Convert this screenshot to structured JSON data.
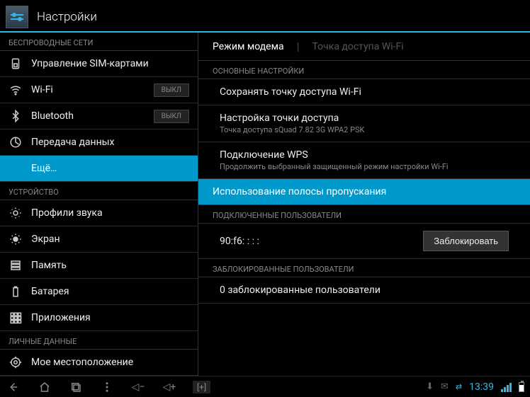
{
  "app_title": "Настройки",
  "sidebar": {
    "sections": [
      {
        "header": "БЕСПРОВОДНЫЕ СЕТИ",
        "items": [
          {
            "icon": "sim",
            "label": "Управление SIM-картами",
            "toggle": null,
            "selected": false
          },
          {
            "icon": "wifi",
            "label": "Wi-Fi",
            "toggle": "ВЫКЛ",
            "selected": false
          },
          {
            "icon": "bluetooth",
            "label": "Bluetooth",
            "toggle": "ВЫКЛ",
            "selected": false
          },
          {
            "icon": "datausage",
            "label": "Передача данных",
            "toggle": null,
            "selected": false
          },
          {
            "icon": "none",
            "label": "Ещё…",
            "toggle": null,
            "selected": true
          }
        ]
      },
      {
        "header": "УСТРОЙСТВО",
        "items": [
          {
            "icon": "audio",
            "label": "Профили звука",
            "toggle": null,
            "selected": false
          },
          {
            "icon": "display",
            "label": "Экран",
            "toggle": null,
            "selected": false
          },
          {
            "icon": "storage",
            "label": "Память",
            "toggle": null,
            "selected": false
          },
          {
            "icon": "battery",
            "label": "Батарея",
            "toggle": null,
            "selected": false
          },
          {
            "icon": "apps",
            "label": "Приложения",
            "toggle": null,
            "selected": false
          }
        ]
      },
      {
        "header": "ЛИЧНЫЕ ДАННЫЕ",
        "items": [
          {
            "icon": "location",
            "label": "Мое местоположение",
            "toggle": null,
            "selected": false
          }
        ]
      }
    ]
  },
  "main": {
    "tabs": {
      "active": "Режим модема",
      "inactive": "Точка доступа Wi-Fi"
    },
    "groups": [
      {
        "header": "ОСНОВНЫЕ НАСТРОЙКИ",
        "items": [
          {
            "title": "Сохранять точку доступа Wi-Fi",
            "sub": null,
            "highlighted": false
          },
          {
            "title": "Настройка точки доступа",
            "sub": "Точка доступа sQuad 7.82 3G WPA2 PSK",
            "highlighted": false
          },
          {
            "title": "Подключение WPS",
            "sub": "Продолжить выбранный защищенный режим настройки Wi-Fi",
            "highlighted": false
          },
          {
            "title": "Использование полосы пропускания",
            "sub": null,
            "highlighted": true
          }
        ]
      },
      {
        "header": "ПОДКЛЮЧЕННЫЕ ПОЛЬЗОВАТЕЛИ",
        "items": [
          {
            "title": "90:f6:   :   :   :",
            "sub": null,
            "button": "Заблокировать"
          }
        ]
      },
      {
        "header": "ЗАБЛОКИРОВАННЫЕ ПОЛЬЗОВАТЕЛИ",
        "items": [
          {
            "title": "0 заблокированные пользователи",
            "sub": null
          }
        ]
      }
    ]
  },
  "navbar": {
    "clock": "13:39"
  }
}
